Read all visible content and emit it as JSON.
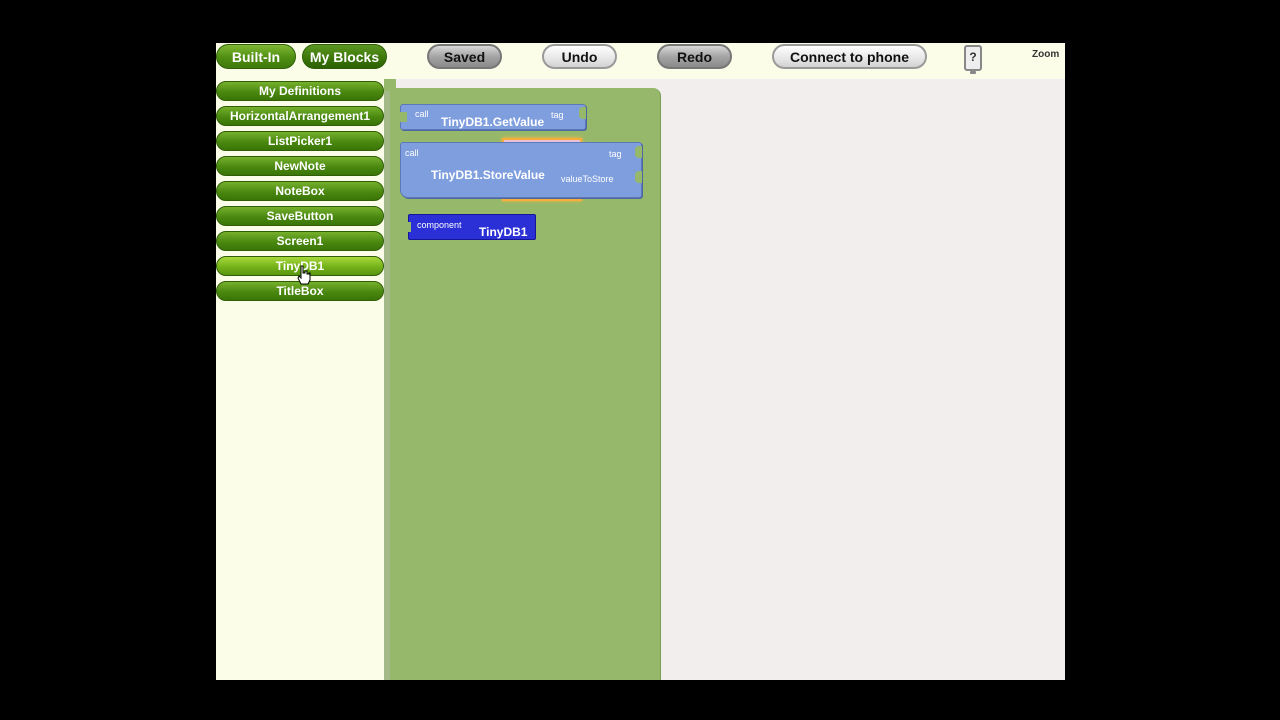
{
  "toolbar": {
    "tabs": [
      {
        "label": "Built-In"
      },
      {
        "label": "My Blocks"
      }
    ],
    "buttons": {
      "saved": "Saved",
      "undo": "Undo",
      "redo": "Redo",
      "connect": "Connect to phone",
      "help": "?",
      "zoom": "Zoom"
    }
  },
  "drawers": {
    "items": [
      {
        "label": "My Definitions"
      },
      {
        "label": "HorizontalArrangement1"
      },
      {
        "label": "ListPicker1"
      },
      {
        "label": "NewNote"
      },
      {
        "label": "NoteBox"
      },
      {
        "label": "SaveButton"
      },
      {
        "label": "Screen1"
      },
      {
        "label": "TinyDB1"
      },
      {
        "label": "TitleBox"
      }
    ]
  },
  "blocks": {
    "getvalue": {
      "keyword": "call",
      "name": "TinyDB1.GetValue",
      "socket": "tag"
    },
    "storevalue": {
      "keyword": "call",
      "name": "TinyDB1.StoreValue",
      "socket1": "tag",
      "socket2": "valueToStore"
    },
    "component": {
      "keyword": "component",
      "name": "TinyDB1"
    }
  },
  "colors": {
    "drawer_green": "#4a8810",
    "method_block": "#7f9ede",
    "component_block": "#2a2fd6",
    "drawer_bg": "#96b86a"
  }
}
